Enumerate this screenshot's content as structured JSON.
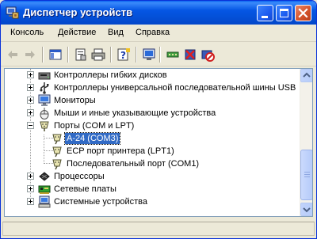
{
  "window": {
    "title": "Диспетчер устройств",
    "icon": "device-manager-icon",
    "controls": {
      "minimize": "minimize-icon",
      "maximize": "maximize-icon",
      "close": "close-icon"
    }
  },
  "menu": {
    "items": [
      {
        "label": "Консоль"
      },
      {
        "label": "Действие"
      },
      {
        "label": "Вид"
      },
      {
        "label": "Справка"
      }
    ]
  },
  "toolbar": {
    "buttons": [
      "back-arrow-icon",
      "forward-arrow-icon",
      "console-tree-icon",
      "properties-icon",
      "print-icon",
      "help-icon",
      "scan-hardware-icon",
      "update-driver-icon",
      "uninstall-icon",
      "disable-device-icon"
    ]
  },
  "tree": {
    "items": [
      {
        "label": "Контроллеры гибких дисков",
        "icon": "floppy-controller-icon",
        "state": "collapsed"
      },
      {
        "label": "Контроллеры универсальной последовательной шины USB",
        "icon": "usb-icon",
        "state": "collapsed"
      },
      {
        "label": "Мониторы",
        "icon": "monitor-icon",
        "state": "collapsed"
      },
      {
        "label": "Мыши и иные указывающие устройства",
        "icon": "mouse-icon",
        "state": "collapsed"
      },
      {
        "label": "Порты (COM и LPT)",
        "icon": "port-icon",
        "state": "expanded"
      },
      {
        "label": "A-24 (COM3)",
        "icon": "port-device-icon",
        "state": "leaf",
        "selected": true
      },
      {
        "label": "ECP порт принтера (LPT1)",
        "icon": "port-device-icon",
        "state": "leaf"
      },
      {
        "label": "Последовательный порт (COM1)",
        "icon": "port-device-icon",
        "state": "leaf"
      },
      {
        "label": "Процессоры",
        "icon": "processor-icon",
        "state": "collapsed"
      },
      {
        "label": "Сетевые платы",
        "icon": "network-card-icon",
        "state": "collapsed"
      },
      {
        "label": "Системные устройства",
        "icon": "system-devices-icon",
        "state": "collapsed"
      }
    ]
  },
  "colors": {
    "titlebar": "#0450d7",
    "selection": "#316ac5",
    "close_button": "#d5542c"
  }
}
